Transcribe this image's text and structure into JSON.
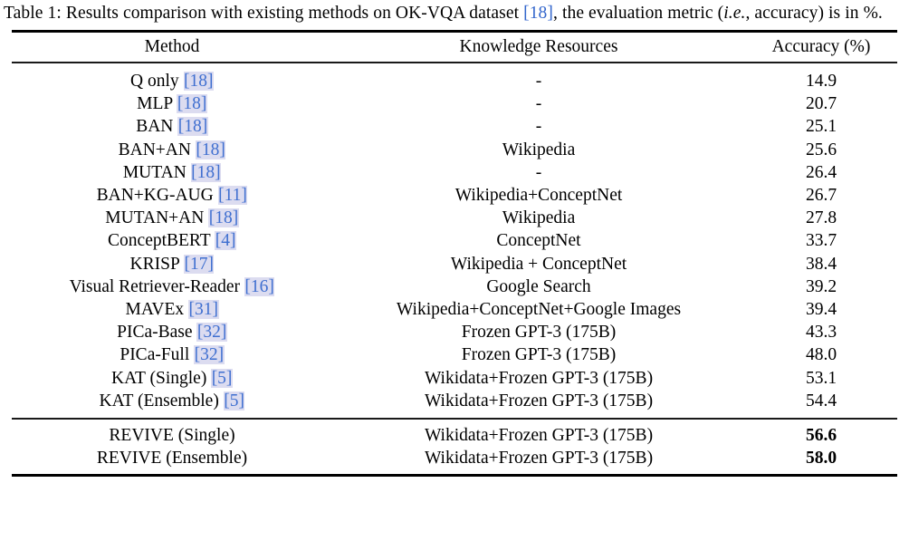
{
  "caption": {
    "prefix": "Table 1: Results comparison with existing methods on OK-VQA dataset ",
    "citation": "[18]",
    "suffix_1": ", the evaluation metric (",
    "italic": "i.e.",
    "suffix_2": ", accuracy) is in %."
  },
  "colors": {
    "citation_text": "#3f6fd0",
    "citation_highlight": "#dcdcf0",
    "caption_citation_text": "#3366cc",
    "rule": "#000000"
  },
  "table": {
    "headers": {
      "method": "Method",
      "knowledge": "Knowledge Resources",
      "accuracy": "Accuracy (%)"
    },
    "rows": [
      {
        "method": "Q only",
        "citation": "[18]",
        "knowledge": "-",
        "accuracy": "14.9",
        "bold": false
      },
      {
        "method": "MLP",
        "citation": "[18]",
        "knowledge": "-",
        "accuracy": "20.7",
        "bold": false
      },
      {
        "method": "BAN",
        "citation": "[18]",
        "knowledge": "-",
        "accuracy": "25.1",
        "bold": false
      },
      {
        "method": "BAN+AN",
        "citation": "[18]",
        "knowledge": "Wikipedia",
        "accuracy": "25.6",
        "bold": false
      },
      {
        "method": "MUTAN",
        "citation": "[18]",
        "knowledge": "-",
        "accuracy": "26.4",
        "bold": false
      },
      {
        "method": "BAN+KG-AUG",
        "citation": "[11]",
        "knowledge": "Wikipedia+ConceptNet",
        "accuracy": "26.7",
        "bold": false
      },
      {
        "method": "MUTAN+AN",
        "citation": "[18]",
        "knowledge": "Wikipedia",
        "accuracy": "27.8",
        "bold": false
      },
      {
        "method": "ConceptBERT",
        "citation": "[4]",
        "knowledge": "ConceptNet",
        "accuracy": "33.7",
        "bold": false
      },
      {
        "method": "KRISP",
        "citation": "[17]",
        "knowledge": "Wikipedia + ConceptNet",
        "accuracy": "38.4",
        "bold": false
      },
      {
        "method": "Visual Retriever-Reader",
        "citation": "[16]",
        "knowledge": "Google Search",
        "accuracy": "39.2",
        "bold": false
      },
      {
        "method": "MAVEx",
        "citation": "[31]",
        "knowledge": "Wikipedia+ConceptNet+Google Images",
        "accuracy": "39.4",
        "bold": false
      },
      {
        "method": "PICa-Base",
        "citation": "[32]",
        "knowledge": "Frozen GPT-3 (175B)",
        "accuracy": "43.3",
        "bold": false
      },
      {
        "method": "PICa-Full",
        "citation": "[32]",
        "knowledge": "Frozen GPT-3 (175B)",
        "accuracy": "48.0",
        "bold": false
      },
      {
        "method": "KAT (Single)",
        "citation": "[5]",
        "knowledge": "Wikidata+Frozen GPT-3 (175B)",
        "accuracy": "53.1",
        "bold": false
      },
      {
        "method": "KAT (Ensemble)",
        "citation": "[5]",
        "knowledge": "Wikidata+Frozen GPT-3 (175B)",
        "accuracy": "54.4",
        "bold": false
      }
    ],
    "highlight_rows": [
      {
        "method": "REVIVE (Single)",
        "citation": "",
        "knowledge": "Wikidata+Frozen GPT-3 (175B)",
        "accuracy": "56.6",
        "bold": true
      },
      {
        "method": "REVIVE (Ensemble)",
        "citation": "",
        "knowledge": "Wikidata+Frozen GPT-3 (175B)",
        "accuracy": "58.0",
        "bold": true
      }
    ]
  }
}
